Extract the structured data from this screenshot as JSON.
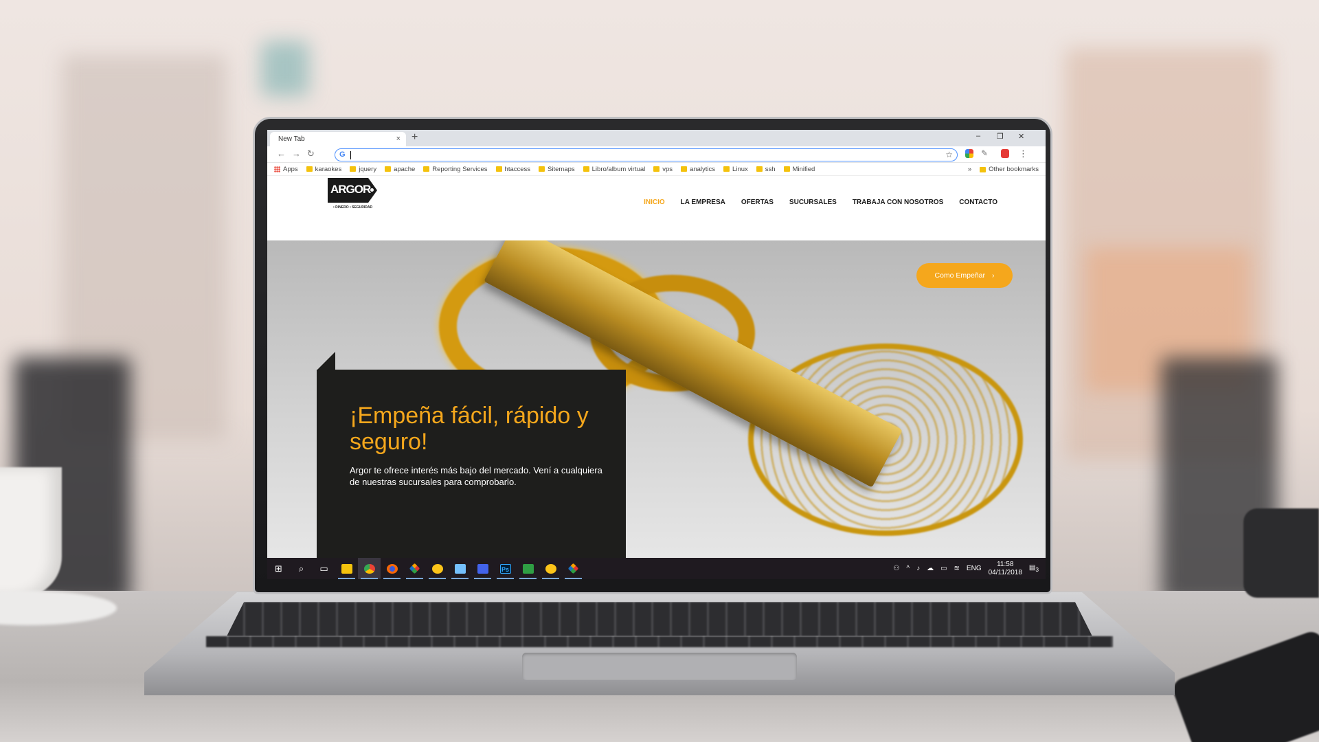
{
  "browser": {
    "tab_title": "New Tab",
    "tab_close": "×",
    "new_tab": "+",
    "window_controls": [
      "–",
      "❐",
      "✕"
    ],
    "omnibox_value": "",
    "bookmarks": [
      "Apps",
      "karaokes",
      "jquery",
      "apache",
      "Reporting Services",
      "htaccess",
      "Sitemaps",
      "Libro/album virtual",
      "vps",
      "analytics",
      "Linux",
      "ssh",
      "Minified"
    ],
    "bookmarks_overflow": "»",
    "other_bookmarks": "Other bookmarks"
  },
  "site": {
    "logo_text": "ARGOR",
    "logo_tagline": "• DINERO • SEGURIDAD",
    "nav": [
      "INICIO",
      "LA EMPRESA",
      "OFERTAS",
      "SUCURSALES",
      "TRABAJA CON NOSOTROS",
      "CONTACTO"
    ],
    "nav_active": "INICIO",
    "cta_label": "Como Empeñar",
    "cta_arrow": "›",
    "hero_title": "¡Empeña fácil, rápido y seguro!",
    "hero_text": "Argor te ofrece interés más bajo del mercado. Vení a cualquiera de nuestras sucursales para comprobarlo.",
    "accent_color": "#f5a71c"
  },
  "taskbar": {
    "icons": [
      "windows-start-icon",
      "search-icon",
      "task-view-icon",
      "file-explorer-icon",
      "chrome-icon",
      "firefox-icon",
      "git-icon",
      "duck-app-icon",
      "box-app-icon",
      "network-app-icon",
      "photoshop-icon",
      "spreadsheet-icon",
      "duck-app-icon",
      "git-icon"
    ],
    "photoshop_label": "Ps",
    "language": "ENG",
    "time": "11:58",
    "date": "04/11/2018",
    "notifications": "3"
  }
}
